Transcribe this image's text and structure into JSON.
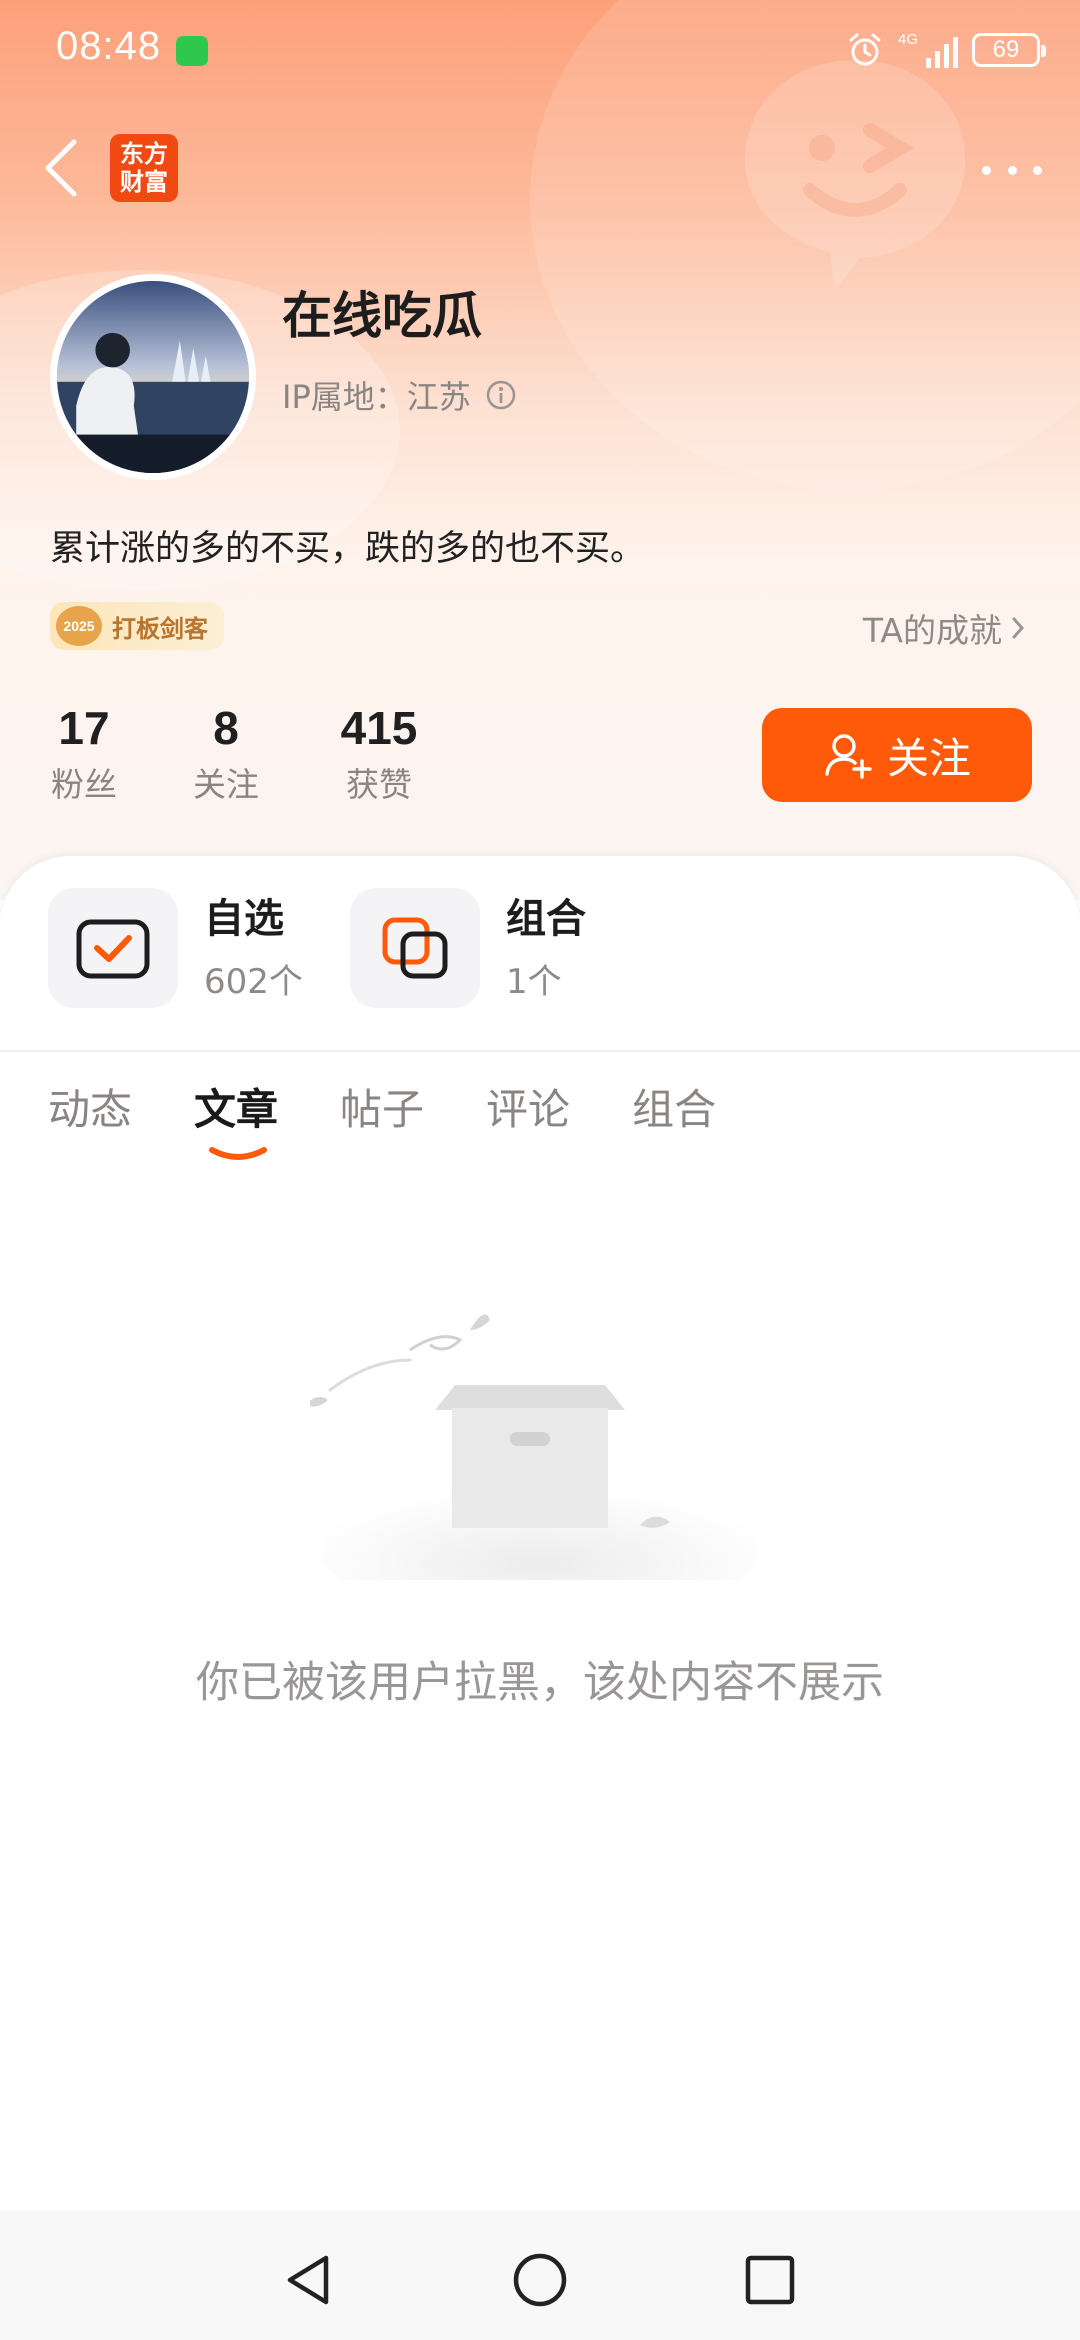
{
  "status_bar": {
    "time": "08:48",
    "network": "4G",
    "battery": "69"
  },
  "nav": {
    "logo_text": "东方\n财富"
  },
  "profile": {
    "name": "在线吃瓜",
    "ip_location": "IP属地：江苏",
    "bio": "累计涨的多的不买，跌的多的也不买。",
    "badge_year": "2025",
    "badge_label": "打板剑客",
    "achievement_link": "TA的成就"
  },
  "stats": [
    {
      "value": "17",
      "label": "粉丝"
    },
    {
      "value": "8",
      "label": "关注"
    },
    {
      "value": "415",
      "label": "获赞"
    }
  ],
  "follow_button": "关注",
  "features": [
    {
      "title": "自选",
      "sub": "602个"
    },
    {
      "title": "组合",
      "sub": "1个"
    }
  ],
  "tabs": [
    "动态",
    "文章",
    "帖子",
    "评论",
    "组合"
  ],
  "active_tab": "文章",
  "empty_state": {
    "message": "你已被该用户拉黑，该处内容不展示"
  },
  "colors": {
    "accent": "#ff5a0a",
    "header_top": "#fda07a",
    "logo_bg": "#f04a12"
  },
  "icons": [
    "back-icon",
    "more-icon",
    "info-icon",
    "chevron-right-icon",
    "user-plus-icon",
    "checkbox-icon",
    "portfolio-icon",
    "alarm-icon",
    "wechat-icon"
  ]
}
